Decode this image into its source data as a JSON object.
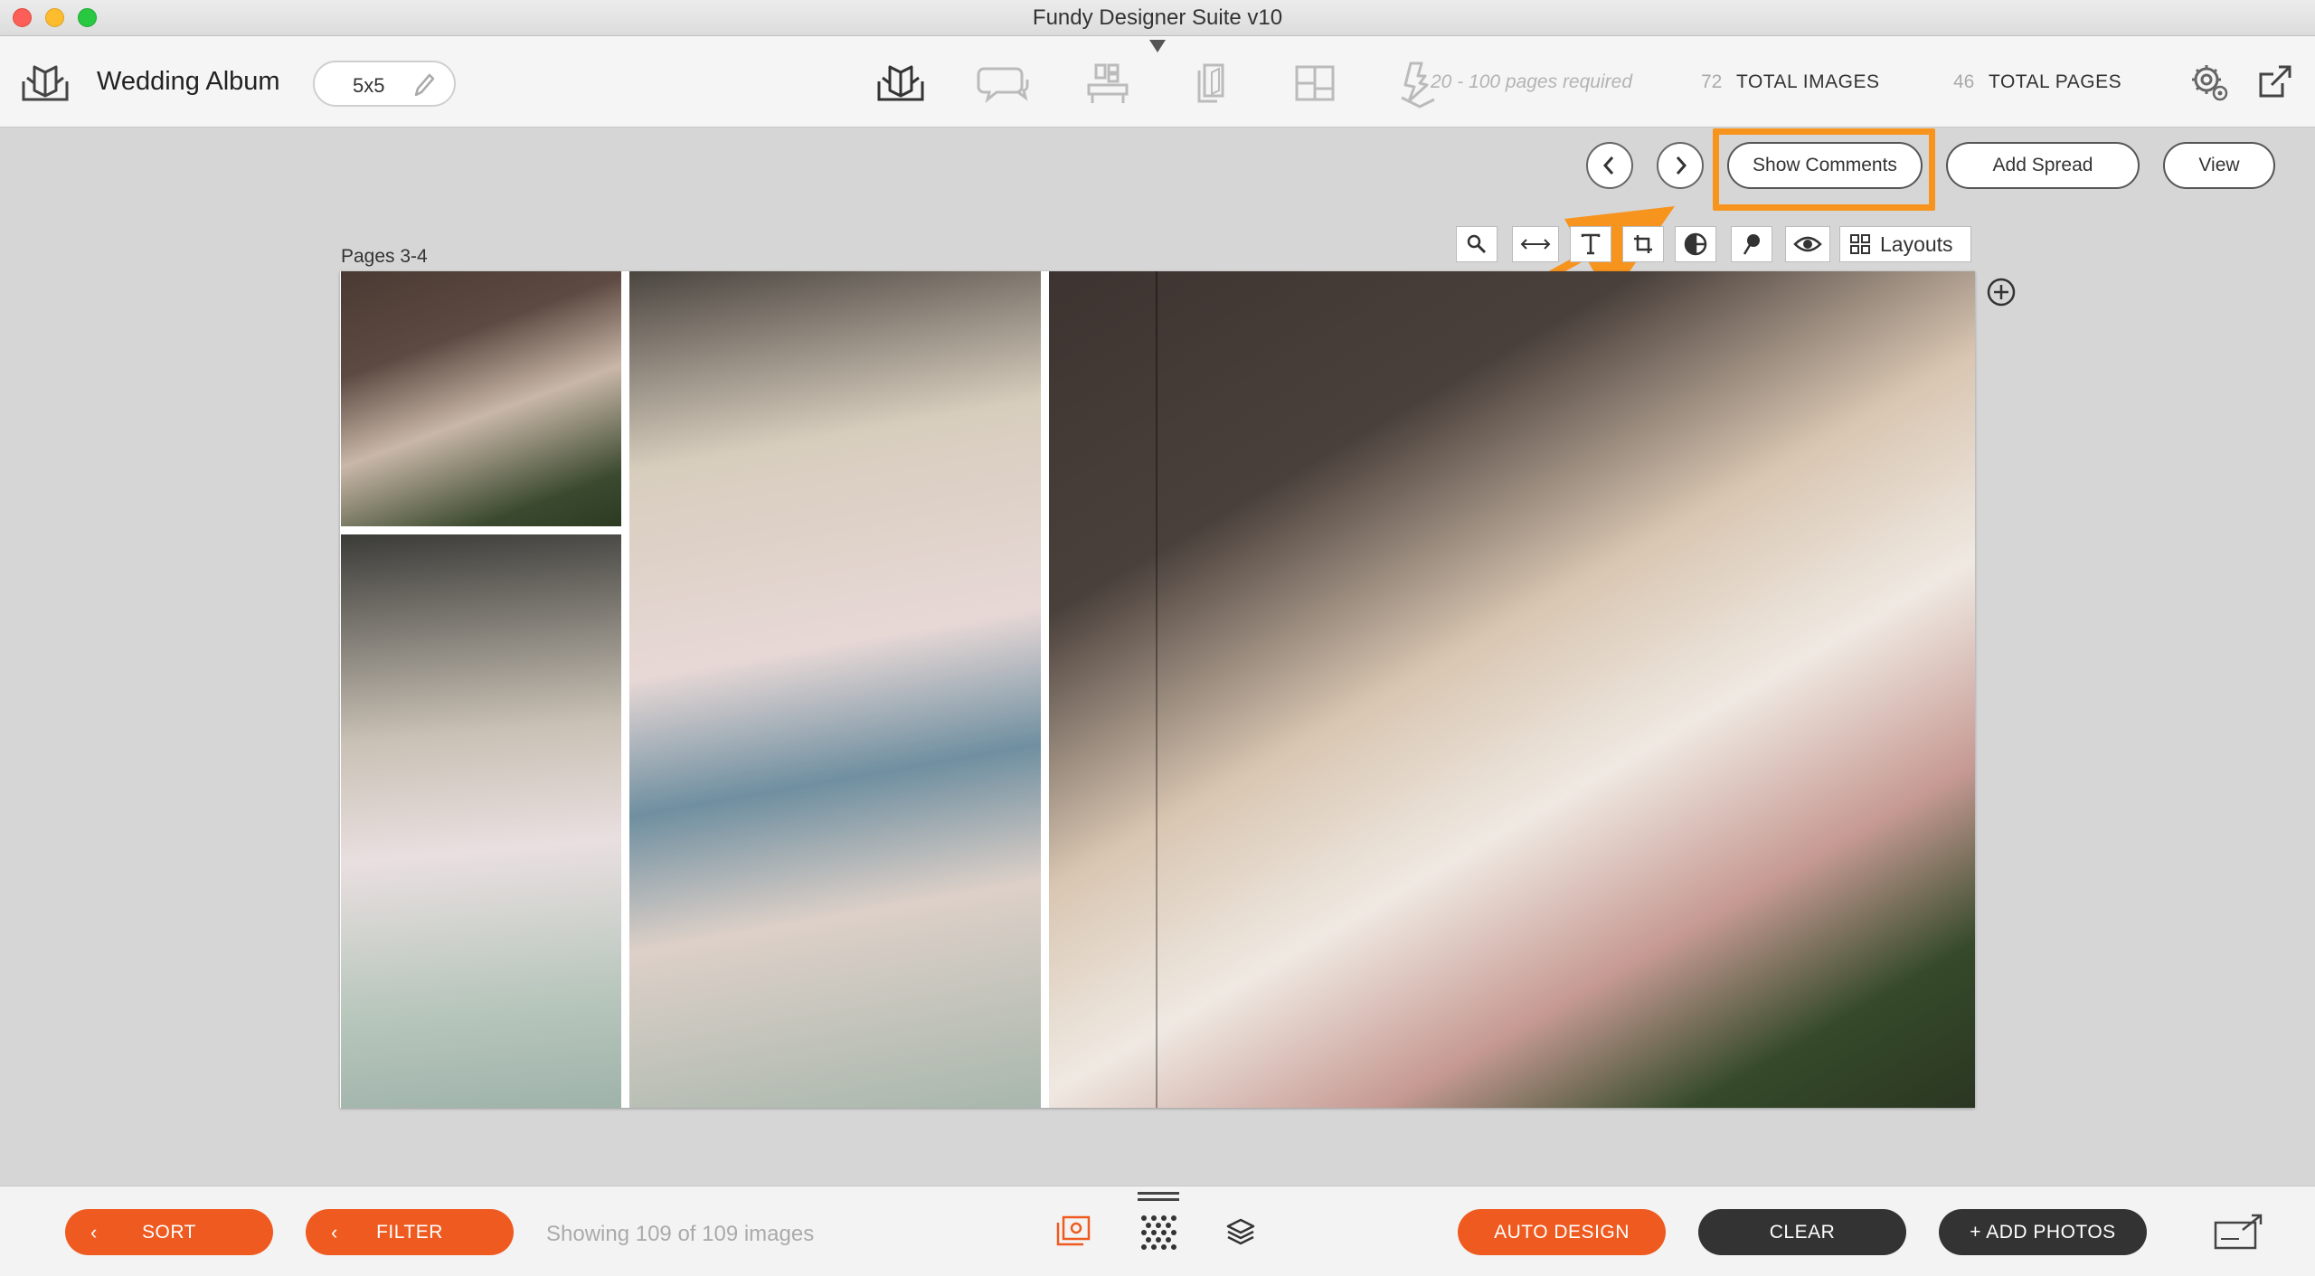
{
  "window": {
    "title": "Fundy Designer Suite v10"
  },
  "toolbar": {
    "album_title": "Wedding Album",
    "album_size": "5x5",
    "pages_required": "20 - 100 pages required",
    "total_images_count": "72",
    "total_images_label": "TOTAL IMAGES",
    "total_pages_count": "46",
    "total_pages_label": "TOTAL PAGES",
    "icons": [
      "album-designer-icon",
      "proofing-comments-icon",
      "layout-templates-icon",
      "pages-icon",
      "cover-designer-icon",
      "products-icon",
      "settings-gear-icon",
      "export-icon"
    ]
  },
  "nav": {
    "show_comments": "Show Comments",
    "add_spread": "Add Spread",
    "view": "View"
  },
  "editor": {
    "pages_label": "Pages 3-4",
    "layouts_label": "Layouts",
    "tool_icons": [
      "zoom-icon",
      "spread-width-icon",
      "text-icon",
      "crop-icon",
      "color-wheel-icon",
      "pin-icon",
      "eye-icon",
      "layouts-grid-icon"
    ]
  },
  "bottom": {
    "sort": "SORT",
    "filter": "FILTER",
    "showing": "Showing 109 of 109 images",
    "auto_design": "AUTO DESIGN",
    "clear": "CLEAR",
    "add_photos": "+ ADD PHOTOS"
  },
  "colors": {
    "accent_orange": "#ee5a1f",
    "highlight": "#f7941d",
    "dark_button": "#333333"
  }
}
